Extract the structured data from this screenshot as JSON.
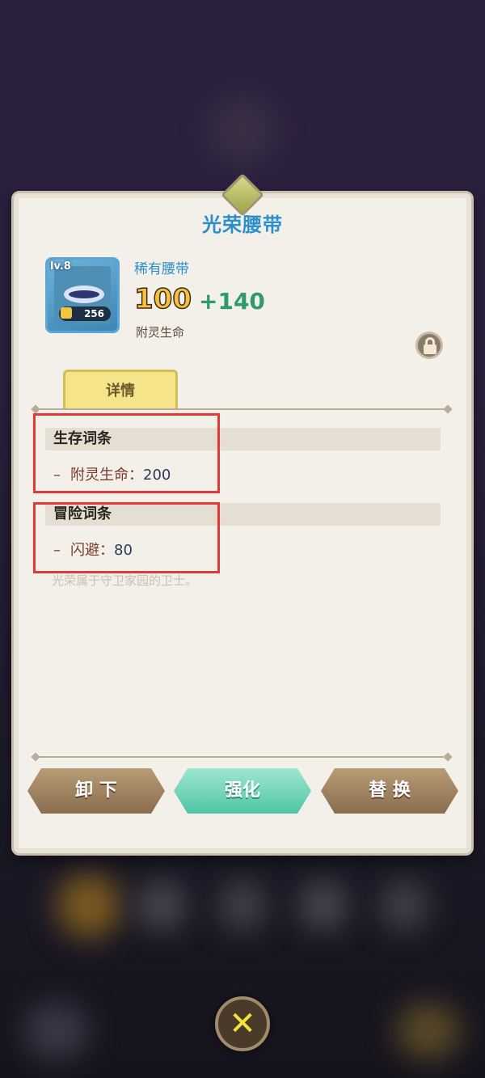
{
  "item": {
    "name": "光荣腰带",
    "rarity": "稀有腰带",
    "level": "lv.8",
    "power": "256",
    "base_value": "100",
    "bonus_value": "+140",
    "attribute_label": "附灵生命",
    "locked": true
  },
  "tabs": [
    {
      "label": "详情",
      "active": true
    }
  ],
  "sections": [
    {
      "title": "生存词条",
      "entries": [
        {
          "label": "附灵生命：",
          "value": "200"
        }
      ]
    },
    {
      "title": "冒险词条",
      "entries": [
        {
          "label": "闪避：",
          "value": "80"
        }
      ]
    }
  ],
  "flavor_text": "光荣属于守卫家园的卫士。",
  "buttons": {
    "unequip": "卸 下",
    "enhance": "强化",
    "replace": "替 换"
  },
  "colors": {
    "title": "#2c8fc9",
    "highlight_box": "#e23a3a",
    "enhance_button": "#4fc5a5"
  },
  "icons": {
    "lock": "lock-icon",
    "close": "close-x-icon",
    "power": "fist-icon",
    "item": "belt-icon"
  }
}
